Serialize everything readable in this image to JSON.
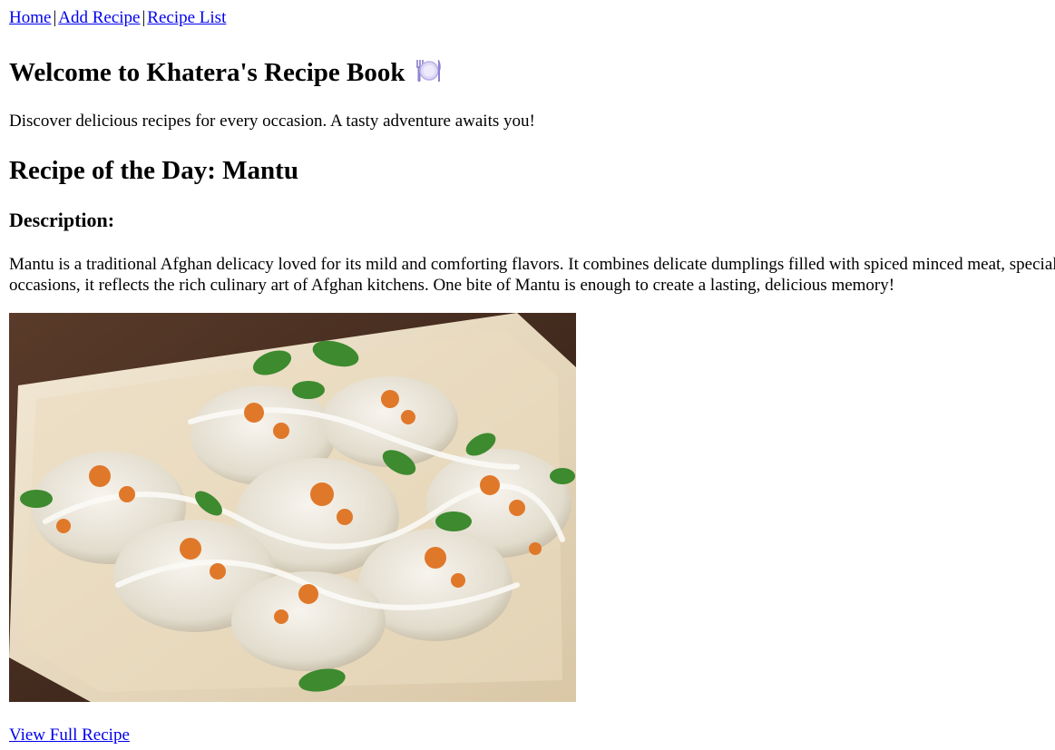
{
  "nav": {
    "home": "Home",
    "add_recipe": "Add Recipe",
    "recipe_list": "Recipe List",
    "separator": "|"
  },
  "header": {
    "title": "Welcome to Khatera's Recipe Book",
    "title_icon": "plate-with-cutlery-icon",
    "intro": "Discover delicious recipes for every occasion. A tasty adventure awaits you!"
  },
  "recipe_of_day": {
    "heading": "Recipe of the Day: Mantu",
    "description_heading": "Description:",
    "description": "Mantu is a traditional Afghan delicacy loved for its mild and comforting flavors. It combines delicate dumplings filled with spiced minced meat, special occasions, it reflects the rich culinary art of Afghan kitchens. One bite of Mantu is enough to create a lasting, delicious memory!",
    "image_subject": "mantu dumplings on a wooden plate",
    "link": "View Full Recipe"
  },
  "colors": {
    "link": "#0000ee",
    "text": "#000000",
    "background": "#ffffff"
  }
}
